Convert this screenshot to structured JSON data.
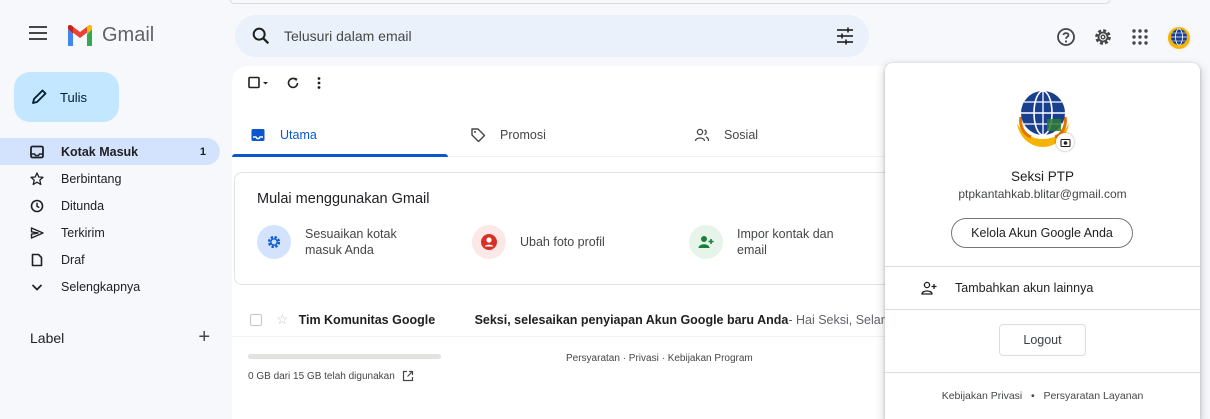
{
  "app": {
    "logo_text": "Gmail",
    "search_placeholder": "Telusuri dalam email"
  },
  "compose": {
    "label": "Tulis"
  },
  "nav": {
    "items": [
      {
        "label": "Kotak Masuk",
        "count": "1",
        "icon": "inbox-icon",
        "active": true
      },
      {
        "label": "Berbintang",
        "count": "",
        "icon": "star-icon"
      },
      {
        "label": "Ditunda",
        "count": "",
        "icon": "clock-icon"
      },
      {
        "label": "Terkirim",
        "count": "",
        "icon": "send-icon"
      },
      {
        "label": "Draf",
        "count": "",
        "icon": "draft-icon"
      },
      {
        "label": "Selengkapnya",
        "count": "",
        "icon": "chevron-down-icon"
      }
    ],
    "label_header": "Label",
    "label_add": "+"
  },
  "tabs": [
    {
      "label": "Utama",
      "icon": "inbox-icon",
      "active": true
    },
    {
      "label": "Promosi",
      "icon": "tag-icon"
    },
    {
      "label": "Sosial",
      "icon": "people-icon"
    }
  ],
  "getting_started": {
    "title": "Mulai menggunakan Gmail",
    "items": [
      {
        "label": "Sesuaikan kotak masuk Anda",
        "icon": "gear-icon",
        "color": "#d3e3fd"
      },
      {
        "label": "Ubah foto profil",
        "icon": "account-icon",
        "color": "#fce8e6"
      },
      {
        "label": "Impor kontak dan email",
        "icon": "add-contact-icon",
        "color": "#e6f4ea"
      }
    ]
  },
  "email": {
    "sender": "Tim Komunitas Google",
    "subject": "Seksi, selesaikan penyiapan Akun Google baru Anda",
    "snippet": " - Hai Seksi, Selar"
  },
  "storage": {
    "text": "0 GB dari 15 GB telah digunakan",
    "fraction": 0.0
  },
  "footer": {
    "links": "Persyaratan · Privasi · Kebijakan Program"
  },
  "account_popup": {
    "name": "Seksi PTP",
    "email": "ptpkantahkab.blitar@gmail.com",
    "manage_label": "Kelola Akun Google Anda",
    "add_account_label": "Tambahkan akun lainnya",
    "logout_label": "Logout",
    "privacy_label": "Kebijakan Privasi",
    "separator": "•",
    "terms_label": "Persyaratan Layanan"
  },
  "colors": {
    "accent": "#0b57d0",
    "compose_bg": "#c2e7ff",
    "active_nav": "#d3e3fd",
    "gmail_red": "#ea4335",
    "gmail_blue": "#4285f4",
    "gmail_green": "#34a853",
    "gmail_yellow": "#fbbc04"
  }
}
